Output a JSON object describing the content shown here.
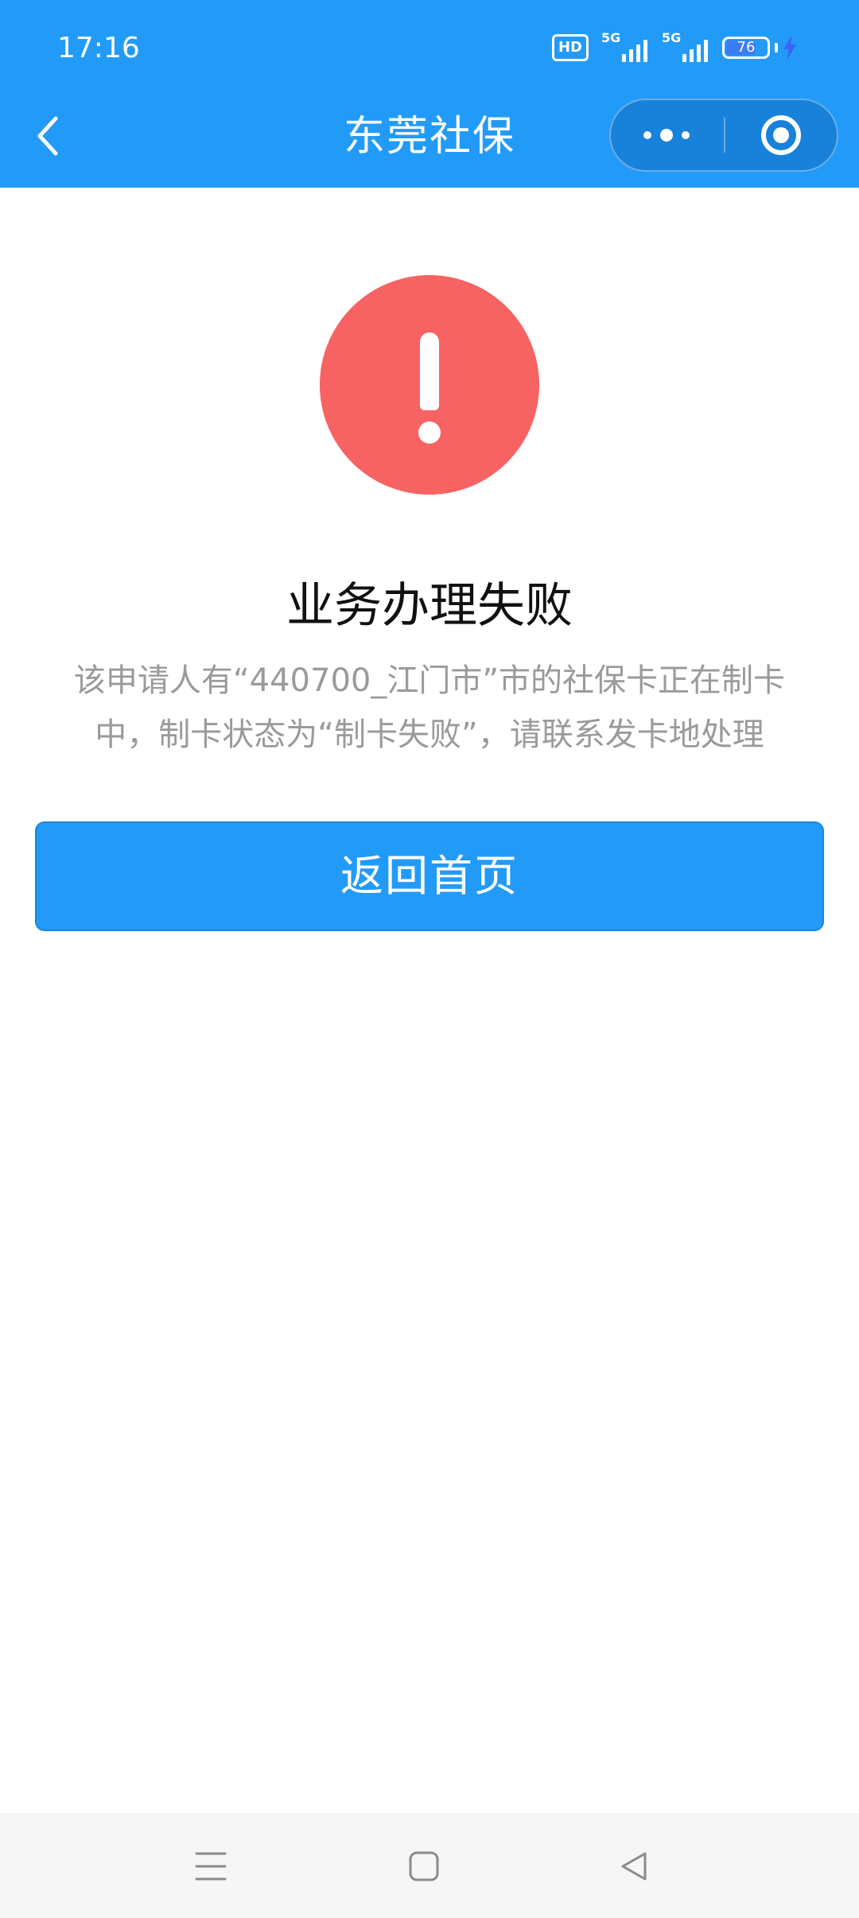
{
  "status_bar": {
    "time": "17:16",
    "hd_label": "HD",
    "signal_1_label": "5G",
    "signal_2_label": "5G",
    "battery_level": "76",
    "charging": true
  },
  "nav": {
    "title": "东莞社保"
  },
  "result": {
    "title": "业务办理失败",
    "message_line_1": "该申请人有“440700_江门市”市的社保卡正在制卡",
    "message_line_2": "中，制卡状态为“制卡失败”，请联系发卡地处理",
    "status_color": "#F76262"
  },
  "actions": {
    "home_button_label": "返回首页"
  },
  "colors": {
    "primary": "#229BF8",
    "error": "#F76262",
    "message_text": "#9A9A9A"
  },
  "icons": {
    "back": "chevron-left-icon",
    "more": "more-dots-icon",
    "close": "target-close-icon",
    "error": "exclamation-circle-icon",
    "sys_menu": "menu-lines-icon",
    "sys_home": "rounded-square-icon",
    "sys_back": "triangle-back-icon"
  }
}
